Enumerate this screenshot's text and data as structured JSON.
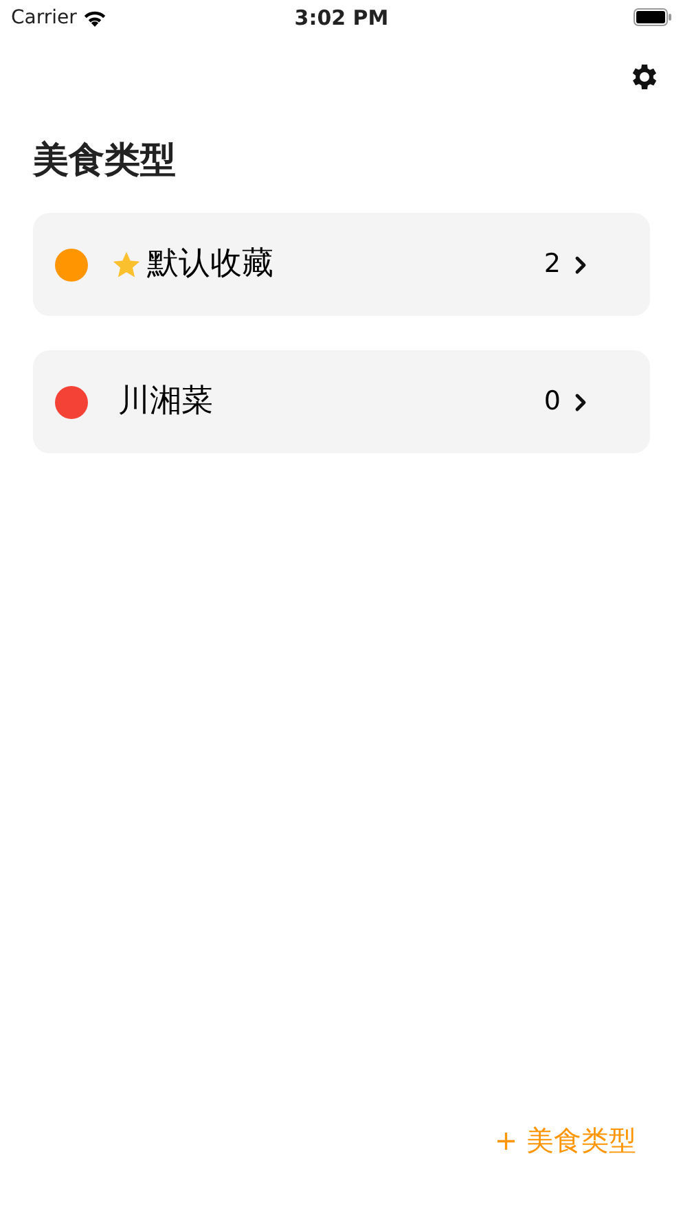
{
  "status_bar": {
    "carrier": "Carrier",
    "time": "3:02 PM"
  },
  "title": "美食类型",
  "categories": [
    {
      "name": "默认收藏",
      "count": "2",
      "color": "#ff9500",
      "favorite": true
    },
    {
      "name": "川湘菜",
      "count": "0",
      "color": "#f44336",
      "favorite": false
    }
  ],
  "add_button": {
    "label": "+ 美食类型"
  }
}
